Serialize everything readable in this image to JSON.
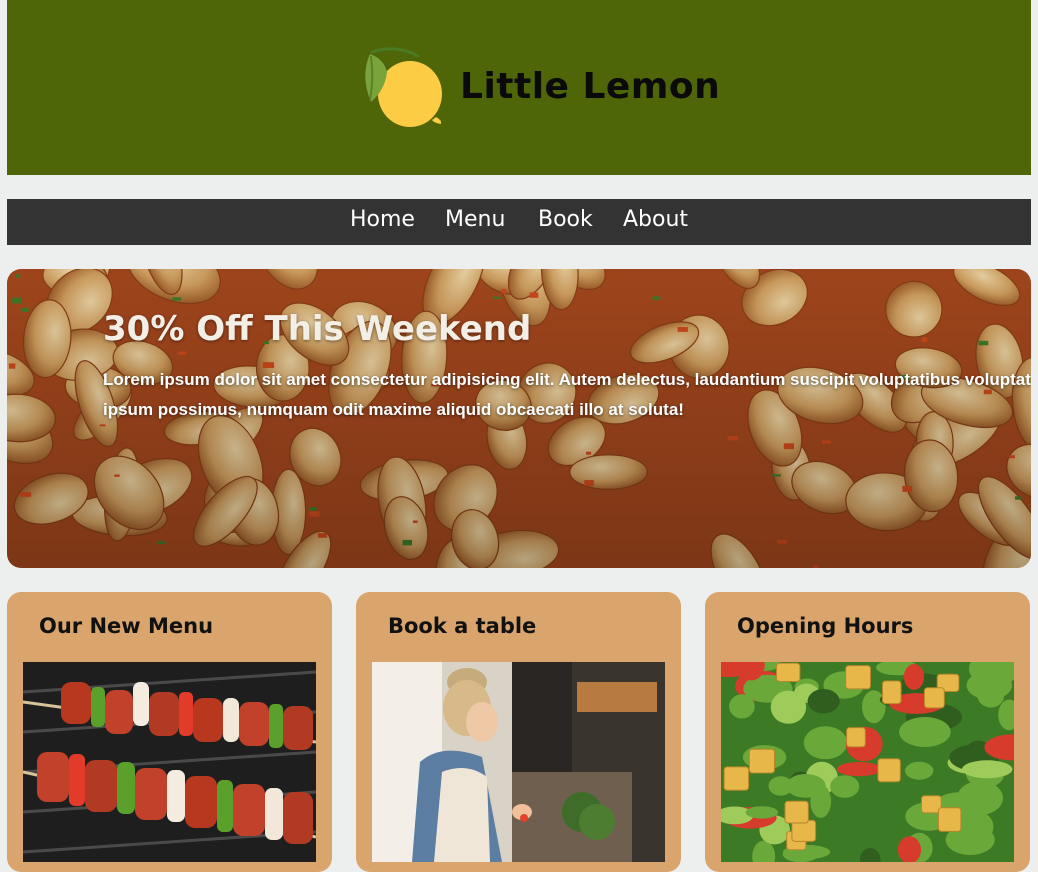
{
  "header": {
    "brand_name": "Little Lemon",
    "logo_icon": "lemon-icon",
    "background_color": "#4e6508"
  },
  "nav": {
    "items": [
      {
        "label": "Home"
      },
      {
        "label": "Menu"
      },
      {
        "label": "Book"
      },
      {
        "label": "About"
      }
    ],
    "background_color": "#333333"
  },
  "hero": {
    "title": "30% Off This Weekend",
    "text": "Lorem ipsum dolor sit amet consectetur adipisicing elit. Autem delectus, laudantium suscipit voluptatibus voluptatum perferendis ipsum possimus, numquam odit maxime aliquid obcaecati illo at soluta!",
    "image": "pasta-dish-photo"
  },
  "cards": [
    {
      "title": "Our New Menu",
      "image": "grilled-kebab-skewers-photo"
    },
    {
      "title": "Book a table",
      "image": "chef-cooking-photo"
    },
    {
      "title": "Opening Hours",
      "image": "salad-with-croutons-photo"
    }
  ],
  "colors": {
    "page_background": "#edeeee",
    "card_background": "#d9a56c",
    "lemon": "#fccc45",
    "leaf": "#7aa33c"
  }
}
